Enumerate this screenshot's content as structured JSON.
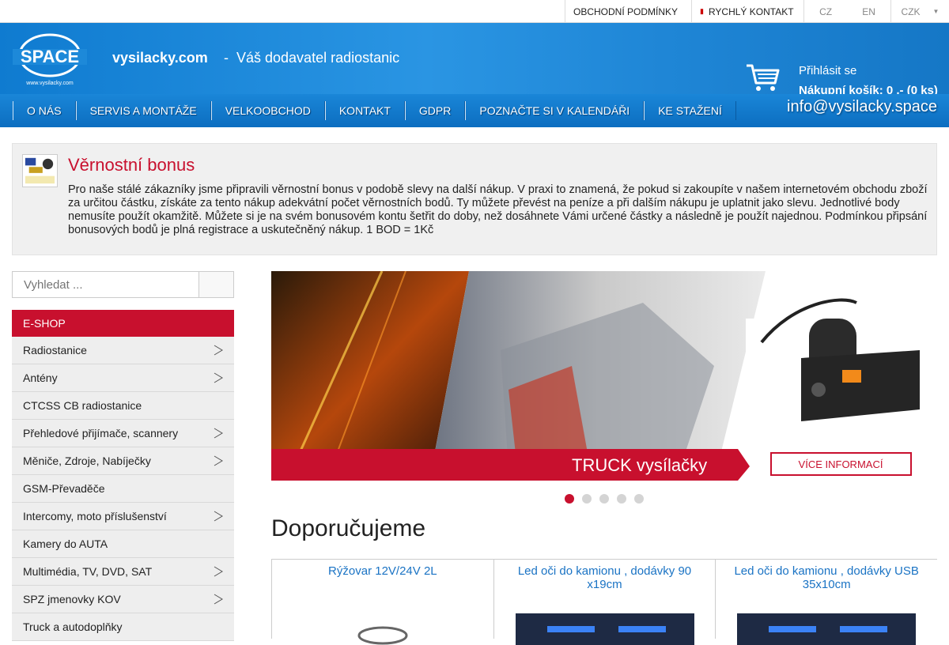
{
  "topbar": {
    "terms": "OBCHODNÍ PODMÍNKY",
    "contact": "RYCHLÝ KONTAKT",
    "languages": [
      "CZ",
      "EN"
    ],
    "currency": "CZK"
  },
  "header": {
    "site_name": "vysilacky.com",
    "separator": "-",
    "tagline": "Váš dodavatel radiostanic",
    "login": "Přihlásit se",
    "cart": "Nákupní košík: 0 ,- (0 ks)",
    "logo_text": "SPACE",
    "logo_url": "www.vysilacky.com"
  },
  "nav": {
    "items": [
      "O NÁS",
      "SERVIS A MONTÁŽE",
      "VELKOOBCHOD",
      "KONTAKT",
      "GDPR",
      "POZNAČTE SI V KALENDÁŘI",
      "KE STAŽENÍ"
    ],
    "email": "info@vysilacky.space"
  },
  "bonus": {
    "title": "Věrnostní bonus",
    "text": "Pro naše stálé zákazníky jsme připravili věrnostní bonus v podobě slevy na další nákup. V praxi to znamená, že pokud si zakoupíte v našem internetovém obchodu zboží za určitou částku, získáte za tento nákup adekvátní počet věrnostních bodů. Ty můžete převést na peníze a při dalším nákupu je uplatnit jako slevu. Jednotlivé body nemusíte použít okamžitě. Můžete si je na svém bonusovém kontu šetřit do doby, než dosáhnete Vámi určené částky a následně je použít najednou. Podmínkou připsání bonusových bodů je plná registrace a uskutečněný nákup. 1 BOD = 1Kč"
  },
  "search": {
    "placeholder": "Vyhledat ..."
  },
  "menu": {
    "head": "E-SHOP",
    "items": [
      {
        "label": "Radiostanice",
        "arrow": true
      },
      {
        "label": "Antény",
        "arrow": true
      },
      {
        "label": "CTCSS CB radiostanice",
        "arrow": false
      },
      {
        "label": "Přehledové přijímače, scannery",
        "arrow": true
      },
      {
        "label": "Měniče, Zdroje, Nabíječky",
        "arrow": true
      },
      {
        "label": "GSM-Převaděče",
        "arrow": false
      },
      {
        "label": "Intercomy, moto příslušenství",
        "arrow": true
      },
      {
        "label": "Kamery do AUTA",
        "arrow": false
      },
      {
        "label": "Multimédia, TV, DVD, SAT",
        "arrow": true
      },
      {
        "label": "SPZ jmenovky KOV",
        "arrow": true
      },
      {
        "label": "Truck a autodoplňky",
        "arrow": false
      }
    ]
  },
  "slider": {
    "caption": "TRUCK vysílačky",
    "button": "VÍCE INFORMACÍ",
    "active_slide": 1,
    "slide_count": 5
  },
  "recommended": {
    "title": "Doporučujeme",
    "products": [
      "Rýžovar 12V/24V 2L",
      "Led oči do kamionu , dodávky 90 x19cm",
      "Led oči do kamionu , dodávky USB 35x10cm"
    ]
  },
  "colors": {
    "brand_blue": "#1a86d8",
    "accent_red": "#c8102e",
    "link_blue": "#1a73c4"
  }
}
